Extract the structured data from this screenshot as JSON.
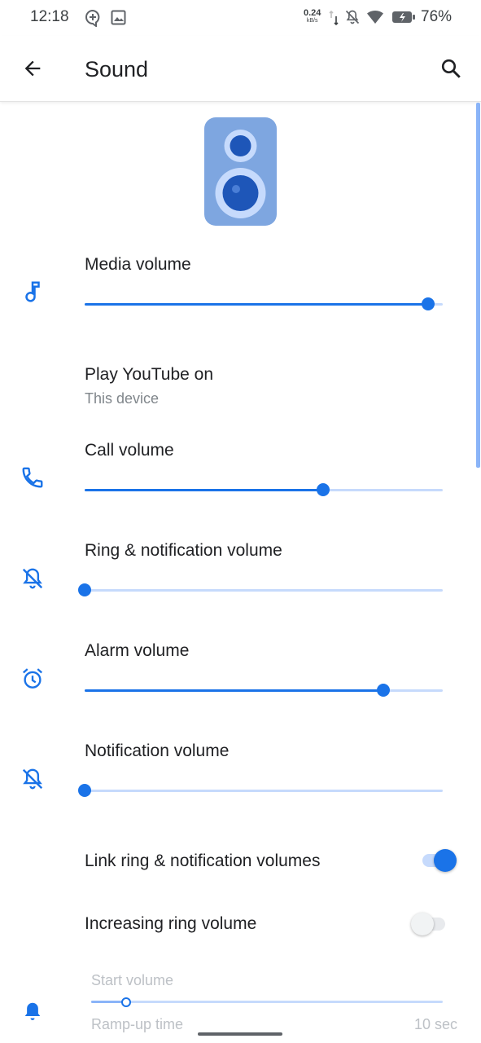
{
  "status_bar": {
    "time": "12:18",
    "net_speed": "0.24",
    "net_unit": "kB/s",
    "battery": "76%"
  },
  "app_bar": {
    "title": "Sound",
    "back_icon": "arrow-back-icon",
    "search_icon": "search-icon"
  },
  "items": {
    "media_volume": {
      "label": "Media volume",
      "icon": "music-note-icon",
      "level": 0.96
    },
    "play_on": {
      "label": "Play YouTube on",
      "value": "This device"
    },
    "call_volume": {
      "label": "Call volume",
      "icon": "phone-icon",
      "level": 0.667
    },
    "ring_volume": {
      "label": "Ring & notification volume",
      "icon": "bell-off-icon",
      "level": 0.0
    },
    "alarm_volume": {
      "label": "Alarm volume",
      "icon": "alarm-icon",
      "level": 0.833
    },
    "notification_volume": {
      "label": "Notification volume",
      "icon": "bell-off-icon",
      "level": 0.0
    },
    "link_ring": {
      "label": "Link ring & notification volumes",
      "on": true
    },
    "increasing_ring": {
      "label": "Increasing ring volume",
      "on": false
    },
    "start_volume": {
      "label": "Start volume",
      "icon": "bell-icon",
      "level": 0.1
    },
    "ramp_up": {
      "label": "Ramp-up time",
      "value": "10 sec"
    }
  },
  "colors": {
    "accent": "#1a73e8",
    "track": "#c6dafc",
    "text_primary": "#202124",
    "text_secondary": "#80868b",
    "text_disabled": "#bdc1c6"
  }
}
